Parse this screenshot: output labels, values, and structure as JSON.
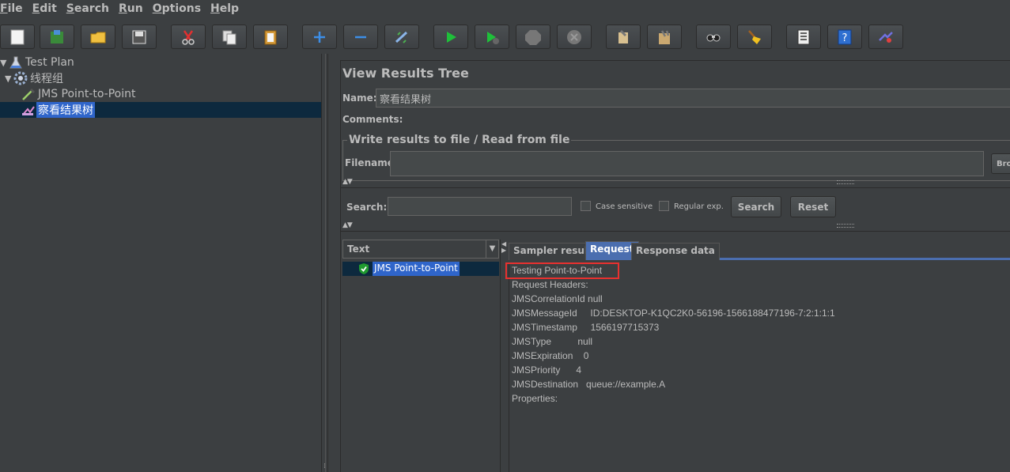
{
  "menu": [
    {
      "underline": "F",
      "rest": "ile"
    },
    {
      "underline": "E",
      "rest": "dit"
    },
    {
      "underline": "S",
      "rest": "earch"
    },
    {
      "underline": "R",
      "rest": "un"
    },
    {
      "underline": "O",
      "rest": "ptions"
    },
    {
      "underline": "H",
      "rest": "elp"
    }
  ],
  "toolbar": {
    "icons": [
      "new-icon",
      "templates-icon",
      "open-icon",
      "save-icon",
      "cut-icon",
      "copy-icon",
      "paste-icon",
      "expand-icon",
      "collapse-icon",
      "toggle-icon",
      "start-icon",
      "start-no-pauses-icon",
      "stop-icon",
      "shutdown-icon",
      "clear-icon",
      "clear-all-icon",
      "search-icon",
      "reset-search-icon",
      "function-helper-icon",
      "help-icon",
      "remote-start-icon"
    ]
  },
  "tree": {
    "items": [
      {
        "label": "Test Plan"
      },
      {
        "label": "线程组"
      },
      {
        "label": "JMS Point-to-Point"
      },
      {
        "label": "察看结果树"
      }
    ]
  },
  "panel": {
    "title": "View Results Tree",
    "name_label": "Name:",
    "name_value": "察看结果树",
    "comments_label": "Comments:",
    "group_title": "Write results to file / Read from file",
    "filename_label": "Filename",
    "browse_label": "Bro"
  },
  "search": {
    "label": "Search:",
    "case_sensitive": "Case sensitive",
    "regular_exp": "Regular exp.",
    "search_button": "Search",
    "reset_button": "Reset"
  },
  "results": {
    "header": "Text",
    "items": [
      {
        "label": "JMS Point-to-Point",
        "status": "success"
      }
    ]
  },
  "tabs": [
    "Sampler result",
    "Request",
    "Response data"
  ],
  "active_tab": "Request",
  "request_lines": [
    "Testing Point-to-Point",
    "Request Headers:",
    "JMSCorrelationId null",
    "JMSMessageId     ID:DESKTOP-K1QC2K0-56196-1566188477196-7:2:1:1:1",
    "JMSTimestamp     1566197715373",
    "JMSType          null",
    "JMSExpiration    0",
    "JMSPriority      4",
    "JMSDestination   queue://example.A",
    "Properties:"
  ],
  "colors": {
    "background": "#3c3f41",
    "selection": "#2f65ca",
    "tab_active": "#4b6eaf",
    "highlight_box": "#e8312f"
  }
}
